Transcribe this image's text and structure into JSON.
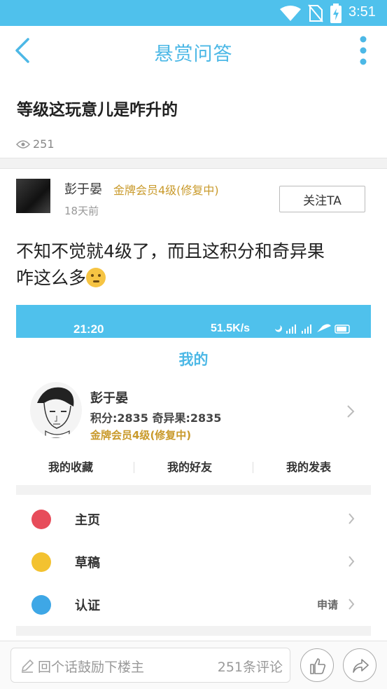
{
  "status_bar": {
    "time": "3:51"
  },
  "nav": {
    "title": "悬赏问答"
  },
  "question": {
    "title": "等级这玩意儿是咋升的",
    "views": "251"
  },
  "author": {
    "name": "彭于晏",
    "level": "金牌会员4级(修复中)",
    "time": "18天前",
    "follow_label": "关注TA"
  },
  "post": {
    "text_line1": "不知不觉就4级了，而且这积分和奇异果",
    "text_line2": "咋这么多"
  },
  "embedded": {
    "time": "21:20",
    "network": "51.5K/s",
    "heading": "我的",
    "name": "彭于晏",
    "points": "积分:2835   奇异果:2835",
    "level": "金牌会员4级(修复中)",
    "tabs": [
      "我的收藏",
      "我的好友",
      "我的发表"
    ],
    "rows": [
      {
        "label": "主页",
        "right": "",
        "color": "#e74c5a"
      },
      {
        "label": "草稿",
        "right": "",
        "color": "#f3c230"
      },
      {
        "label": "认证",
        "right": "申请",
        "color": "#3ea7e6"
      }
    ]
  },
  "bottom": {
    "placeholder": "回个话鼓励下楼主",
    "comment_count": "251条评论"
  },
  "colors": {
    "accent": "#4fc1ec",
    "gold": "#c99a2b"
  }
}
